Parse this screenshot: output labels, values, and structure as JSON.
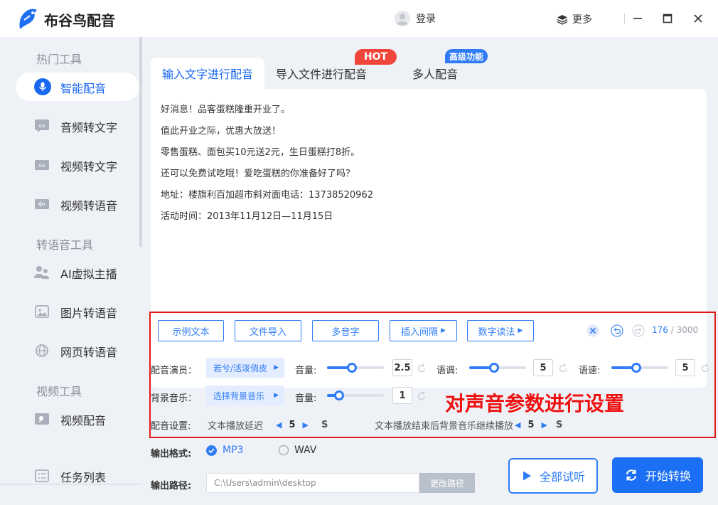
{
  "app": {
    "name": "布谷鸟配音"
  },
  "header": {
    "login_label": "登录",
    "more_label": "更多"
  },
  "colors": {
    "accent": "#1868f0",
    "annotation": "#ee1111",
    "hot_badge": "#f0453a",
    "pro_badge": "#2f7cf6"
  },
  "sidebar": {
    "sections": [
      {
        "title": "热门工具",
        "items": [
          {
            "label": "智能配音",
            "icon": "microphone-icon",
            "active": true
          },
          {
            "label": "音频转文字",
            "icon": "audio-text-icon"
          },
          {
            "label": "视频转文字",
            "icon": "video-text-icon"
          },
          {
            "label": "视频转语音",
            "icon": "video-voice-icon"
          }
        ]
      },
      {
        "title": "转语音工具",
        "items": [
          {
            "label": "AI虚拟主播",
            "icon": "virtual-host-icon"
          },
          {
            "label": "图片转语音",
            "icon": "image-icon"
          },
          {
            "label": "网页转语音",
            "icon": "globe-icon"
          }
        ]
      },
      {
        "title": "视频工具",
        "items": [
          {
            "label": "视频配音",
            "icon": "video-dub-icon"
          }
        ]
      }
    ],
    "task_list_label": "任务列表"
  },
  "tabs": [
    {
      "label": "输入文字进行配音",
      "active": true
    },
    {
      "label": "导入文件进行配音",
      "badge": "HOT"
    },
    {
      "label": "多人配音",
      "badge": "高级功能"
    }
  ],
  "editor": {
    "lines": [
      "好消息！品客蛋糕隆重开业了。",
      "值此开业之际，优惠大放送！",
      "零售蛋糕、面包买10元送2元，生日蛋糕打8折。",
      "还可以免费试吃哦！爱吃蛋糕的你准备好了吗？",
      "地址：楼旗利百加超市斜对面电话：13738520962",
      "活动时间：2013年11月12日—11月15日"
    ]
  },
  "toolbar": {
    "buttons": [
      "示例文本",
      "文件导入",
      "多音字",
      "插入间隔",
      "数字读法"
    ],
    "char_count": "176",
    "char_max": "/ 3000"
  },
  "params": {
    "voice_label": "配音演员：",
    "voice_value": "若兮/活泼俏皮",
    "volume_label": "音量:",
    "volume_value": "2.5",
    "volume_level": 0.43,
    "pitch_label": "语调:",
    "pitch_value": "5",
    "pitch_level": 0.43,
    "speed_label": "语速:",
    "speed_value": "5",
    "speed_level": 0.43,
    "bgm_label": "背景音乐：",
    "bgm_value": "选择背景音乐",
    "bgm_volume_label": "音量:",
    "bgm_volume_value": "1",
    "bgm_volume_level": 0.15,
    "settings_label": "配音设置:",
    "delay_label": "文本播放延迟",
    "delay_value": "5",
    "delay_unit": "S",
    "continue_label": "文本播放结束后背景音乐继续播放",
    "continue_value": "5",
    "continue_unit": "S"
  },
  "annotation": "对声音参数进行设置",
  "output": {
    "format_label": "输出格式:",
    "formats": [
      {
        "label": "MP3",
        "selected": true
      },
      {
        "label": "WAV",
        "selected": false
      }
    ],
    "path_label": "输出路径:",
    "path_value": "C:\\Users\\admin\\desktop",
    "change_path_label": "更改路径",
    "preview_label": "全部试听",
    "start_label": "开始转换"
  }
}
